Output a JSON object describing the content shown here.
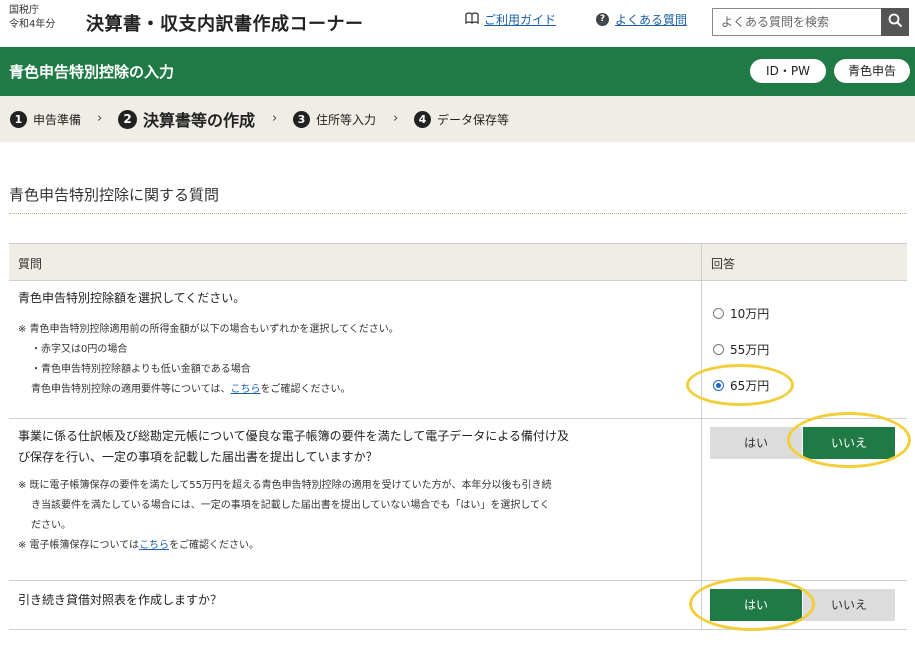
{
  "header": {
    "agency_name": "国税庁",
    "tax_year": "令和4年分",
    "app_title": "決算書・収支内訳書作成コーナー",
    "guide_link": "ご利用ガイド",
    "faq_link": "よくある質問",
    "search_placeholder": "よくある質問を検索",
    "icons": {
      "guide": "book-icon",
      "faq": "question-circle-icon",
      "search": "magnifier-icon"
    }
  },
  "titlebar": {
    "title": "青色申告特別控除の入力",
    "badges": [
      "ID・PW",
      "青色申告"
    ]
  },
  "steps": [
    {
      "num": "1",
      "label": "申告準備",
      "active": false
    },
    {
      "num": "2",
      "label": "決算書等の作成",
      "active": true
    },
    {
      "num": "3",
      "label": "住所等入力",
      "active": false
    },
    {
      "num": "4",
      "label": "データ保存等",
      "active": false
    }
  ],
  "section": {
    "title": "青色申告特別控除に関する質問"
  },
  "table": {
    "col_question": "質問",
    "col_answer": "回答",
    "q1": {
      "text": "青色申告特別控除額を選択してください。",
      "note1": "※ 青色申告特別控除適用前の所得金額が以下の場合もいずれかを選択してください。",
      "note2": "・赤字又は0円の場合",
      "note3": "・青色申告特別控除額よりも低い金額である場合",
      "note4_pre": "青色申告特別控除の適用要件等については、",
      "note4_link": "こちら",
      "note4_post": "をご確認ください。",
      "options": [
        "10万円",
        "55万円",
        "65万円"
      ],
      "selected": "65万円"
    },
    "q2": {
      "text_line1": "事業に係る仕訳帳及び総勘定元帳について優良な電子帳簿の要件を満たして電子データによる備付け及",
      "text_line2": "び保存を行い、一定の事項を記載した届出書を提出していますか？",
      "note1": "※ 既に電子帳簿保存の要件を満たして55万円を超える青色申告特別控除の適用を受けていた方が、本年分以後も引き続",
      "note2": "き当該要件を満たしている場合には、一定の事項を記載した届出書を提出していない場合でも「はい」を選択してく",
      "note3": "ださい。",
      "note4_pre": "※ 電子帳簿保存については",
      "note4_link": "こちら",
      "note4_post": "をご確認ください。",
      "yes": "はい",
      "no": "いいえ",
      "selected": "いいえ"
    },
    "q3": {
      "text": "引き続き貸借対照表を作成しますか？",
      "yes": "はい",
      "no": "いいえ",
      "selected": "はい"
    }
  },
  "colors": {
    "brand_green": "#1f7a45",
    "step_bg": "#efede6",
    "highlight_circle": "#f2cf3a",
    "link_blue": "#1a5fa8"
  }
}
